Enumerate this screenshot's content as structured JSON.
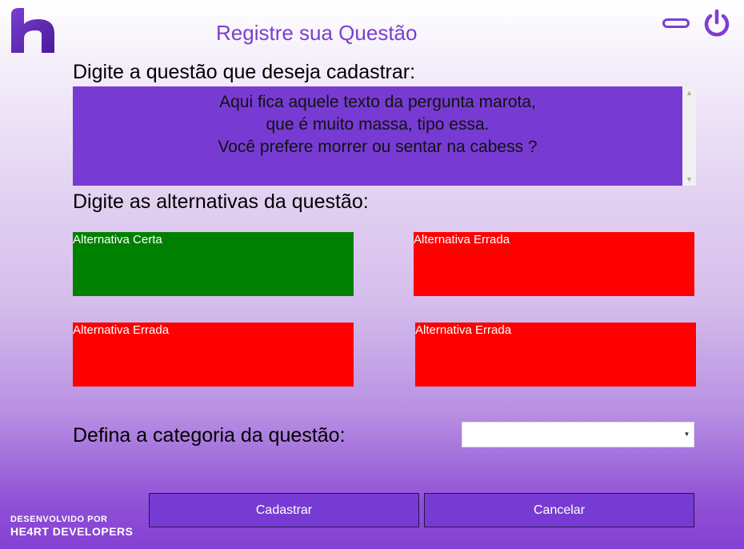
{
  "window": {
    "title": "Registre sua Questão",
    "minimize_icon": "minimize-icon",
    "power_icon": "power-icon",
    "logo_icon": "logo-icon"
  },
  "form": {
    "question_label": "Digite a questão que deseja cadastrar:",
    "question_text": "Aqui fica aquele texto da pergunta marota,\nque é muito massa, tipo essa.\nVocê prefere morrer ou sentar na cabess ?",
    "alternatives_label": "Digite as alternativas da questão:",
    "alternatives": [
      {
        "placeholder": "Alternativa Certa",
        "color": "#008000"
      },
      {
        "placeholder": "Alternativa Errada",
        "color": "#ff0000"
      },
      {
        "placeholder": "Alternativa Errada",
        "color": "#ff0000"
      },
      {
        "placeholder": "Alternativa Errada",
        "color": "#ff0000"
      }
    ],
    "category_label": "Defina a categoria da questão:",
    "category_value": ""
  },
  "actions": {
    "save_label": "Cadastrar",
    "cancel_label": "Cancelar"
  },
  "footer": {
    "credit_line1": "DESENVOLVIDO POR",
    "credit_line2": "HE4RT DEVELOPERS"
  },
  "colors": {
    "accent": "#773bd3",
    "title": "#7c3fd0",
    "correct": "#008000",
    "wrong": "#ff0000"
  }
}
